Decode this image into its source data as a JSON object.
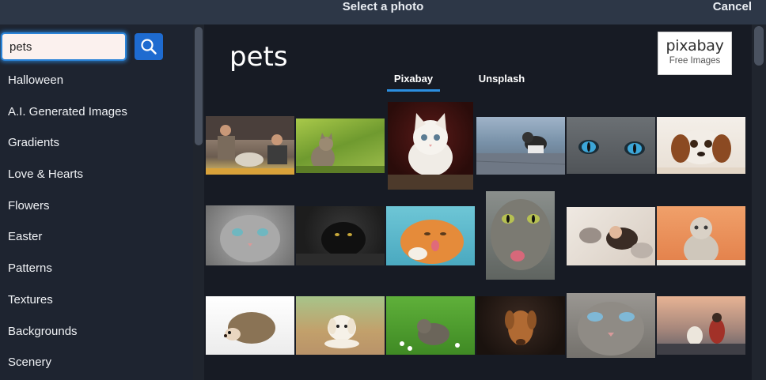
{
  "header": {
    "title": "Select a photo",
    "cancel_label": "Cancel"
  },
  "search": {
    "value": "pets",
    "placeholder": ""
  },
  "categories": [
    "Halloween",
    "A.I. Generated Images",
    "Gradients",
    "Love & Hearts",
    "Flowers",
    "Easter",
    "Patterns",
    "Textures",
    "Backgrounds",
    "Scenery"
  ],
  "main": {
    "query_heading": "pets",
    "tabs": [
      {
        "label": "Pixabay",
        "active": true
      },
      {
        "label": "Unsplash",
        "active": false
      }
    ],
    "provider": {
      "logo_text": "pixabay",
      "subtitle": "Free Images"
    }
  },
  "colors": {
    "accent": "#2b8fe0",
    "search_button": "#1e6bd0",
    "topbar": "#2d3747",
    "sidebar": "#1e2430",
    "main_bg": "#171b24"
  },
  "icons": {
    "search": "search-icon"
  },
  "photos": [
    "people-with-dogs",
    "kitten-in-grass",
    "white-kitten",
    "kitten-on-rocks",
    "cat-blue-eyes-closeup",
    "spaniel-puppy",
    "gray-cat-portrait",
    "black-cat",
    "ginger-cat-licking",
    "tabby-tongue-out",
    "woman-lying-with-cat",
    "scottish-fold-cat",
    "hedgehog",
    "white-puppy",
    "kitten-in-flowers",
    "brown-dog",
    "gray-cat-blue-eyes",
    "couple-with-dog-lake"
  ]
}
